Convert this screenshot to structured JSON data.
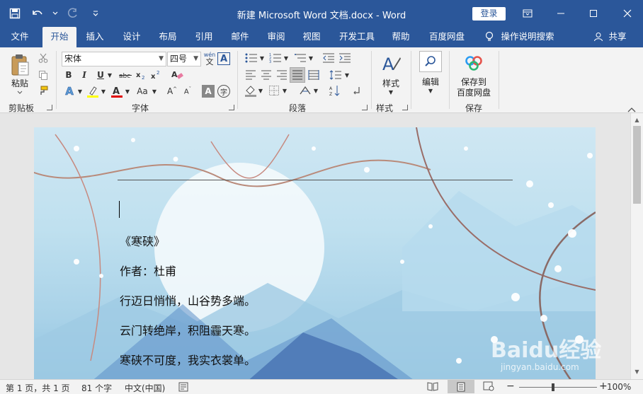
{
  "window": {
    "title": "新建 Microsoft Word 文档.docx  -  Word",
    "login_label": "登录"
  },
  "tabs": [
    {
      "label": "文件"
    },
    {
      "label": "开始",
      "active": true
    },
    {
      "label": "插入"
    },
    {
      "label": "设计"
    },
    {
      "label": "布局"
    },
    {
      "label": "引用"
    },
    {
      "label": "邮件"
    },
    {
      "label": "审阅"
    },
    {
      "label": "视图"
    },
    {
      "label": "开发工具"
    },
    {
      "label": "帮助"
    },
    {
      "label": "百度网盘"
    }
  ],
  "tell_me": "操作说明搜索",
  "share_label": "共享",
  "ribbon": {
    "clipboard": {
      "paste_label": "粘贴",
      "group_label": "剪贴板"
    },
    "font": {
      "font_name": "宋体",
      "font_size": "四号",
      "wen_label": "wén",
      "wen_char": "文",
      "group_label": "字体"
    },
    "paragraph": {
      "group_label": "段落"
    },
    "styles": {
      "label": "样式",
      "group_label": "样式"
    },
    "editing": {
      "label": "编辑"
    },
    "save": {
      "label_line1": "保存到",
      "label_line2": "百度网盘",
      "group_label": "保存"
    }
  },
  "document": {
    "paragraphs": [
      "《寒硖》",
      "作者：杜甫",
      "行迈日悄悄，山谷势多端。",
      "云门转绝岸，积阻霾天寒。",
      "寒硖不可度，我实衣裳单。"
    ]
  },
  "watermark": {
    "text": "Baidu经验",
    "sub": "jingyan.baidu.com"
  },
  "status": {
    "page": "第 1 页，共 1 页",
    "words": "81 个字",
    "language": "中文(中国)",
    "zoom": "100%"
  },
  "colors": {
    "brand": "#2b579a",
    "ribbon": "#f3f3f3"
  }
}
